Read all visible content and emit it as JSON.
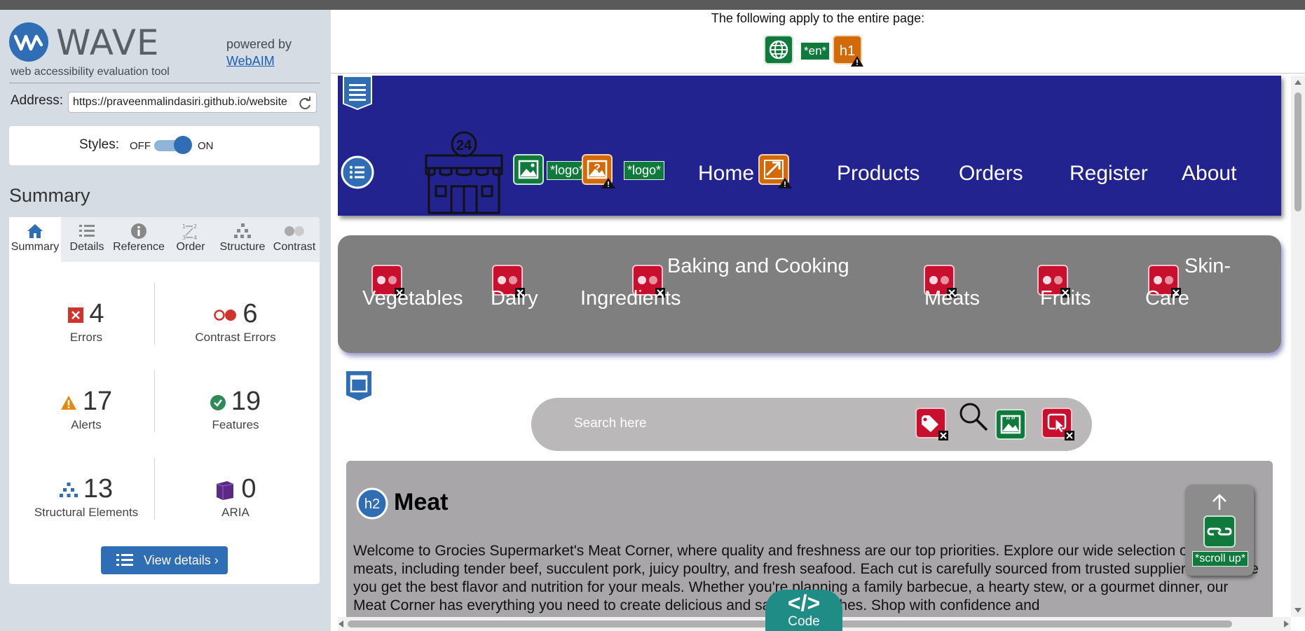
{
  "wave": {
    "logo_word": "WAVE",
    "tagline": "web accessibility evaluation tool",
    "powered_by": "powered by",
    "webaim_link": "WebAIM",
    "address_label": "Address:",
    "address_value": "https://praveenmalindasiri.github.io/website",
    "styles_label": "Styles:",
    "styles_off": "OFF",
    "styles_on": "ON",
    "styles_state": "on",
    "summary_heading": "Summary",
    "tabs": [
      {
        "label": "Summary",
        "icon": "home-icon",
        "active": true
      },
      {
        "label": "Details",
        "icon": "list-icon",
        "active": false
      },
      {
        "label": "Reference",
        "icon": "info-icon",
        "active": false
      },
      {
        "label": "Order",
        "icon": "order-icon",
        "active": false
      },
      {
        "label": "Structure",
        "icon": "structure-icon",
        "active": false
      },
      {
        "label": "Contrast",
        "icon": "contrast-icon",
        "active": false
      }
    ],
    "stats": {
      "errors": {
        "count": "4",
        "label": "Errors",
        "color": "#d0342c"
      },
      "contrast_errors": {
        "count": "6",
        "label": "Contrast Errors",
        "color": "#d0342c"
      },
      "alerts": {
        "count": "17",
        "label": "Alerts",
        "color": "#e48a14"
      },
      "features": {
        "count": "19",
        "label": "Features",
        "color": "#2e8b57"
      },
      "structural": {
        "count": "13",
        "label": "Structural Elements",
        "color": "#2f6db5"
      },
      "aria": {
        "count": "0",
        "label": "ARIA",
        "color": "#5b2a86"
      }
    },
    "view_details": "View details ›"
  },
  "preview": {
    "page_note": "The following apply to the entire page:",
    "page_icons": [
      {
        "name": "language-feature-icon"
      },
      {
        "name": "lang-en-chip",
        "text": "*en*"
      },
      {
        "name": "h1-alert-icon",
        "text": "h1"
      }
    ],
    "site": {
      "nav": [
        "Home",
        "Products",
        "Orders",
        "Register",
        "About"
      ],
      "logo_chip": "*logo*",
      "categories": [
        {
          "line1": "",
          "line2": "Vegetables"
        },
        {
          "line1": "",
          "line2": "Dairy"
        },
        {
          "line1": "Baking and Cooking",
          "line2": "Ingredients"
        },
        {
          "line1": "",
          "line2": "Meats"
        },
        {
          "line1": "",
          "line2": "Fruits"
        },
        {
          "line1": "Skin-",
          "line2": "Care"
        }
      ],
      "search_placeholder": "Search here",
      "section_heading_tag": "h2",
      "section_heading": "Meat",
      "section_text": "Welcome to Grocies Supermarket's Meat Corner, where quality and freshness are our top priorities. Explore our wide selection of premium meats, including tender beef, succulent pork, juicy poultry, and fresh seafood. Each cut is carefully sourced from trusted suppliers to ensure you get the best flavor and nutrition for your meals. Whether you're planning a family barbecue, a hearty stew, or a gourmet dinner, our Meat Corner has everything you need to create delicious and satisfying dishes. Shop with confidence and",
      "scroll_up_chip": "*scroll up*"
    },
    "code_tab_glyph": "</>",
    "code_tab_label": "Code"
  }
}
